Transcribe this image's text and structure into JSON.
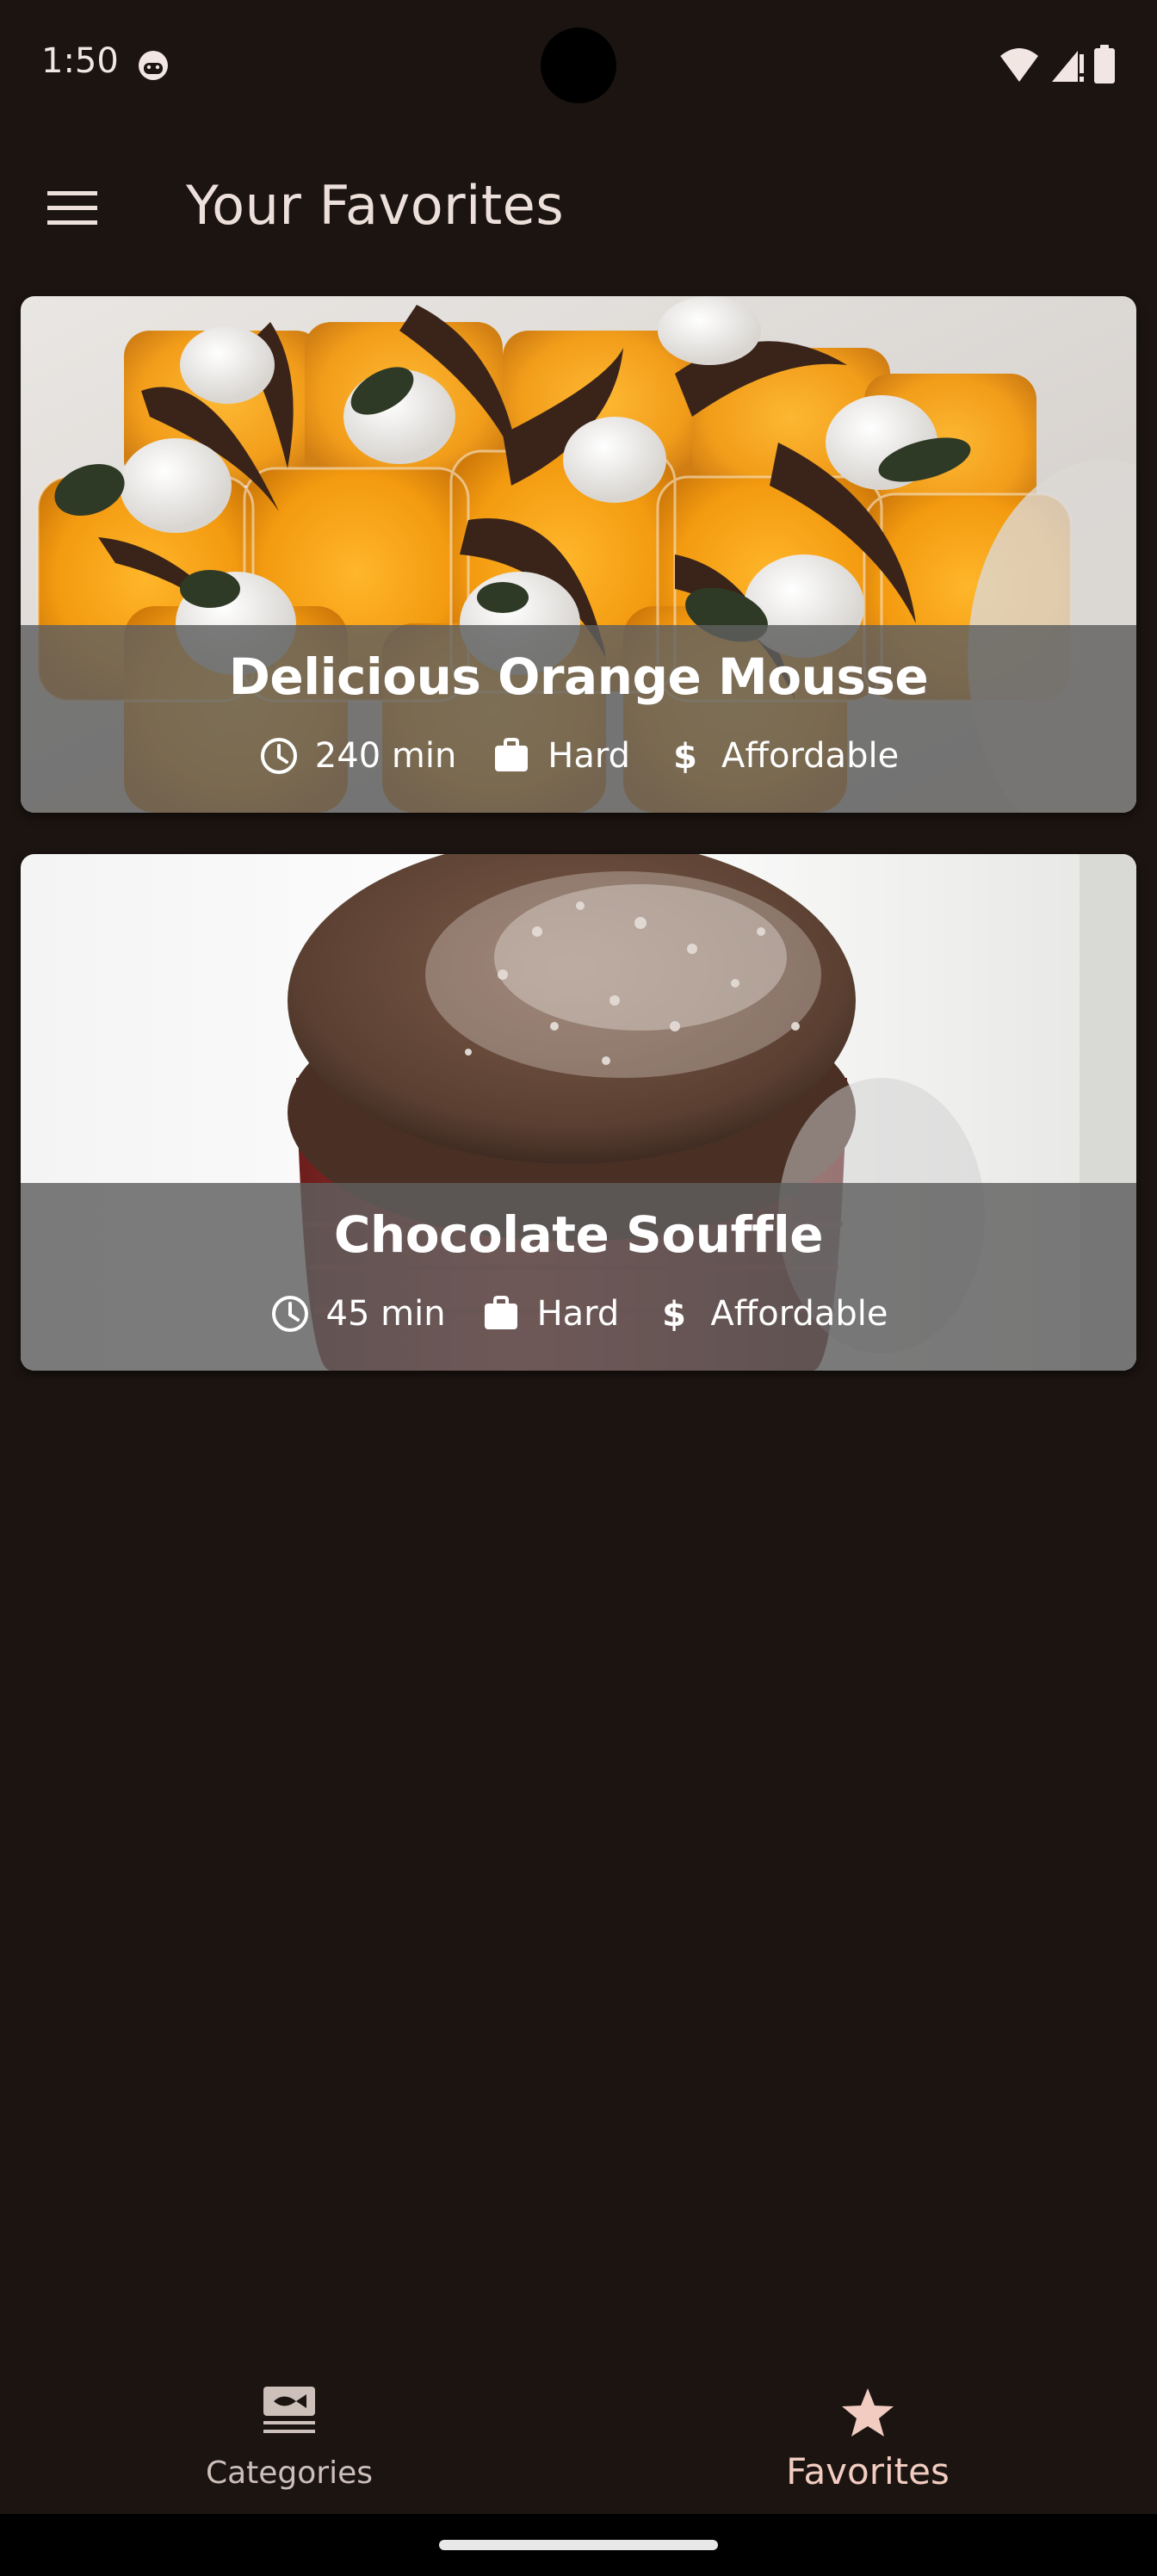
{
  "status_bar": {
    "time": "1:50"
  },
  "app_bar": {
    "title": "Your Favorites",
    "menu_icon": "hamburger-menu-icon"
  },
  "meals": [
    {
      "title": "Delicious Orange Mousse",
      "duration": "240 min",
      "complexity": "Hard",
      "affordability": "Affordable"
    },
    {
      "title": "Chocolate Souffle",
      "duration": "45 min",
      "complexity": "Hard",
      "affordability": "Affordable"
    }
  ],
  "bottom_nav": {
    "items": [
      {
        "label": "Categories",
        "icon": "set-meal-icon",
        "active": false
      },
      {
        "label": "Favorites",
        "icon": "star-icon",
        "active": true
      }
    ]
  },
  "colors": {
    "background": "#1b1411",
    "overlay": "#5f5f5f",
    "active_nav": "#f2ccc0",
    "inactive_nav": "#cdbfb9"
  }
}
